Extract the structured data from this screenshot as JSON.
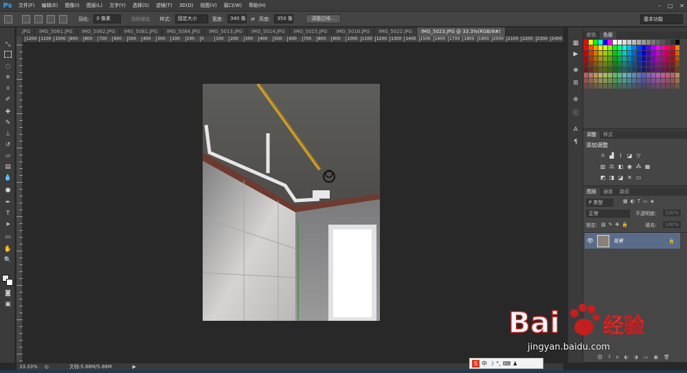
{
  "app": {
    "logo": "Ps",
    "window_controls": [
      "–",
      "□",
      "✕"
    ]
  },
  "menus": [
    "文件(F)",
    "编辑(E)",
    "图像(I)",
    "图层(L)",
    "文字(Y)",
    "选择(S)",
    "滤镜(T)",
    "3D(D)",
    "视图(V)",
    "窗口(W)",
    "帮助(H)"
  ],
  "options": {
    "feather_label": "羽化:",
    "feather_value": "0 像素",
    "antialias_label": "消除锯齿",
    "style_label": "样式:",
    "style_value": "固定大小",
    "width_label": "宽度:",
    "width_value": "340 像",
    "height_label": "高度:",
    "height_value": "350 像",
    "refine_edge": "调整边缘...",
    "workspace": "基本功能"
  },
  "tabs": [
    {
      "label": ".JPG",
      "active": false
    },
    {
      "label": "IMG_5061.JPG",
      "active": false
    },
    {
      "label": "IMG_5062.JPG",
      "active": false
    },
    {
      "label": "IMG_5081.JPG",
      "active": false
    },
    {
      "label": "IMG_5084.JPG",
      "active": false
    },
    {
      "label": "IMG_5013.JPG",
      "active": false
    },
    {
      "label": "IMG_5014.JPG",
      "active": false
    },
    {
      "label": "IMG_5015.JPG",
      "active": false
    },
    {
      "label": "IMG_5016.JPG",
      "active": false
    },
    {
      "label": "IMG_5022.JPG",
      "active": false
    },
    {
      "label": "IMG_5023.JPG @ 33.3%(RGB/8#)",
      "active": true
    }
  ],
  "ruler_ticks": [
    "1200",
    "1100",
    "1000",
    "900",
    "800",
    "700",
    "600",
    "500",
    "400",
    "300",
    "200",
    "100",
    "0",
    "100",
    "200",
    "300",
    "400",
    "500",
    "600",
    "700",
    "800",
    "900",
    "1000",
    "1100",
    "1200",
    "1300",
    "1400",
    "1500",
    "1600",
    "1700",
    "1800",
    "1900",
    "2000",
    "2100",
    "2200",
    "2300",
    "2400"
  ],
  "status": {
    "zoom": "33.33%",
    "doc_info": "文档:5.88M/5.88M"
  },
  "panels": {
    "color_tab": "颜色",
    "swatches_tab": "色板",
    "adjust_tab": "调整",
    "styles_tab": "样式",
    "add_adjustment": "添加调整",
    "layers_tab": "图层",
    "channels_tab": "通道",
    "paths_tab": "路径",
    "kind_label": "P 类型",
    "blend_mode": "正常",
    "opacity_label": "不透明度:",
    "opacity_value": "100%",
    "lock_label": "锁定:",
    "fill_label": "填充:",
    "fill_value": "100%",
    "layer_name": "背景"
  },
  "ime": {
    "label": "中"
  },
  "watermark": {
    "text": "Bai",
    "brand": "经验",
    "url": "jingyan.baidu.com"
  },
  "colors": {
    "accent": "#30a8ff",
    "layer_selected": "#5a6c89",
    "canvas_bg": "#282828"
  }
}
